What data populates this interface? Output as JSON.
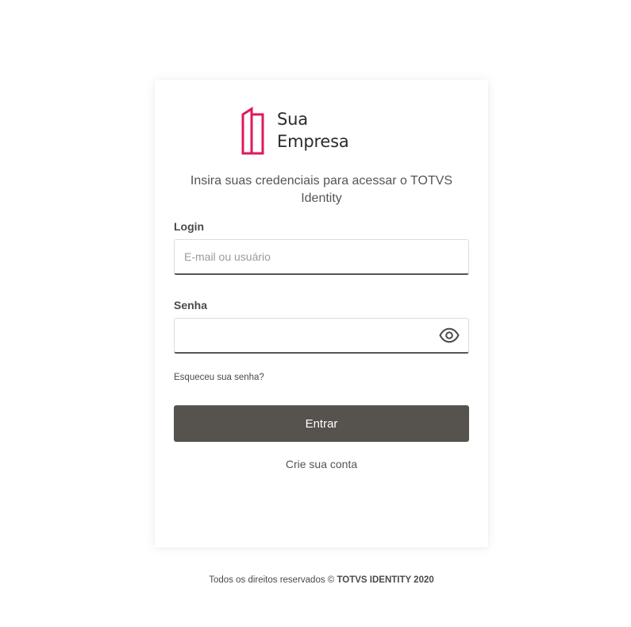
{
  "brand": {
    "name_line1": "Sua",
    "name_line2": "Empresa",
    "accent_color": "#e0195a",
    "icon": "building-outline-icon"
  },
  "login_form": {
    "subtitle": "Insira suas credenciais para acessar o TOTVS Identity",
    "login_label": "Login",
    "login_placeholder": "E-mail ou usuário",
    "login_value": "",
    "password_label": "Senha",
    "password_value": "",
    "show_password_icon": "eye-icon",
    "forgot_password_link": "Esqueceu sua senha?",
    "submit_label": "Entrar",
    "signup_link": "Crie sua conta",
    "button_color": "#56524d"
  },
  "footer": {
    "text": "Todos os direitos reservados ©",
    "brand": "TOTVS IDENTITY 2020"
  }
}
